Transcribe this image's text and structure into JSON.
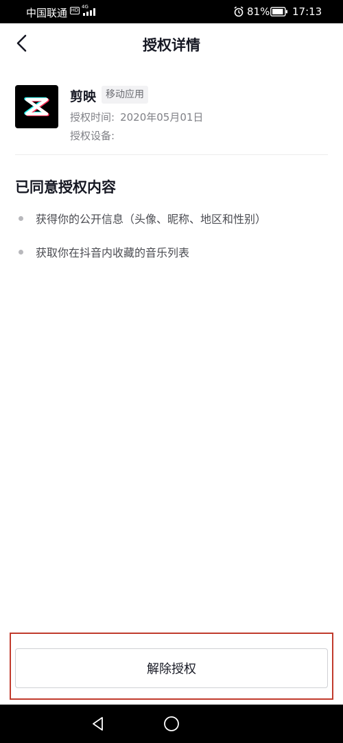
{
  "status_bar": {
    "carrier": "中国联通",
    "hd": "HD",
    "network": "4G",
    "battery": "81%",
    "time": "17:13"
  },
  "header": {
    "title": "授权详情",
    "back_icon": "chevron-left-icon"
  },
  "app": {
    "name": "剪映",
    "type": "移动应用",
    "auth_time_label": "授权时间:",
    "auth_time_value": "2020年05月01日",
    "auth_device_label": "授权设备:",
    "logo_icon": "capcut-logo"
  },
  "permissions": {
    "title": "已同意授权内容",
    "items": [
      "获得你的公开信息（头像、昵称、地区和性别）",
      "获取你在抖音内收藏的音乐列表"
    ]
  },
  "actions": {
    "revoke_label": "解除授权"
  },
  "system_nav": {
    "back_icon": "triangle-back-icon",
    "home_icon": "circle-home-icon"
  }
}
